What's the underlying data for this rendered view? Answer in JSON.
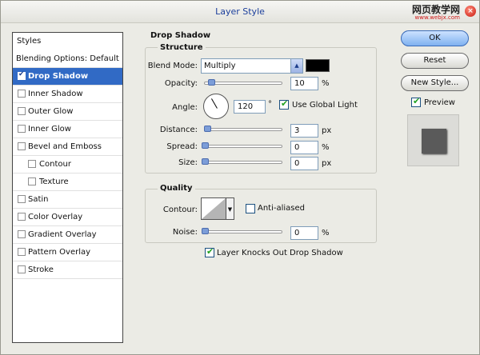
{
  "window": {
    "title": "Layer Style",
    "watermark": "网页教学网",
    "watermark_url": "www.webjx.com"
  },
  "sidebar": {
    "header": "Styles",
    "items": [
      {
        "label": "Blending Options: Default",
        "checkbox": false,
        "checked": false,
        "selected": false,
        "indent": 0
      },
      {
        "label": "Drop Shadow",
        "checkbox": true,
        "checked": true,
        "selected": true,
        "indent": 0
      },
      {
        "label": "Inner Shadow",
        "checkbox": true,
        "checked": false,
        "selected": false,
        "indent": 0
      },
      {
        "label": "Outer Glow",
        "checkbox": true,
        "checked": false,
        "selected": false,
        "indent": 0
      },
      {
        "label": "Inner Glow",
        "checkbox": true,
        "checked": false,
        "selected": false,
        "indent": 0
      },
      {
        "label": "Bevel and Emboss",
        "checkbox": true,
        "checked": false,
        "selected": false,
        "indent": 0
      },
      {
        "label": "Contour",
        "checkbox": true,
        "checked": false,
        "selected": false,
        "indent": 1
      },
      {
        "label": "Texture",
        "checkbox": true,
        "checked": false,
        "selected": false,
        "indent": 1
      },
      {
        "label": "Satin",
        "checkbox": true,
        "checked": false,
        "selected": false,
        "indent": 0
      },
      {
        "label": "Color Overlay",
        "checkbox": true,
        "checked": false,
        "selected": false,
        "indent": 0
      },
      {
        "label": "Gradient Overlay",
        "checkbox": true,
        "checked": false,
        "selected": false,
        "indent": 0
      },
      {
        "label": "Pattern Overlay",
        "checkbox": true,
        "checked": false,
        "selected": false,
        "indent": 0
      },
      {
        "label": "Stroke",
        "checkbox": true,
        "checked": false,
        "selected": false,
        "indent": 0
      }
    ]
  },
  "drop_shadow": {
    "title": "Drop Shadow",
    "structure": {
      "title": "Structure",
      "blend_mode_label": "Blend Mode:",
      "blend_mode_value": "Multiply",
      "shadow_color": "#000000",
      "opacity_label": "Opacity:",
      "opacity_value": "10",
      "opacity_unit": "%",
      "angle_label": "Angle:",
      "angle_value": "120",
      "angle_unit": "°",
      "use_global_light_label": "Use Global Light",
      "use_global_light_checked": true,
      "distance_label": "Distance:",
      "distance_value": "3",
      "distance_unit": "px",
      "spread_label": "Spread:",
      "spread_value": "0",
      "spread_unit": "%",
      "size_label": "Size:",
      "size_value": "0",
      "size_unit": "px"
    },
    "quality": {
      "title": "Quality",
      "contour_label": "Contour:",
      "anti_aliased_label": "Anti-aliased",
      "anti_aliased_checked": false,
      "noise_label": "Noise:",
      "noise_value": "0",
      "noise_unit": "%"
    },
    "knockout_label": "Layer Knocks Out Drop Shadow",
    "knockout_checked": true
  },
  "buttons": {
    "ok": "OK",
    "reset": "Reset",
    "new_style": "New Style...",
    "preview_label": "Preview",
    "preview_checked": true
  },
  "colors": {
    "selection": "#316ac5",
    "title_text": "#1c3f9c",
    "preview_swatch": "#5a5a5a"
  }
}
